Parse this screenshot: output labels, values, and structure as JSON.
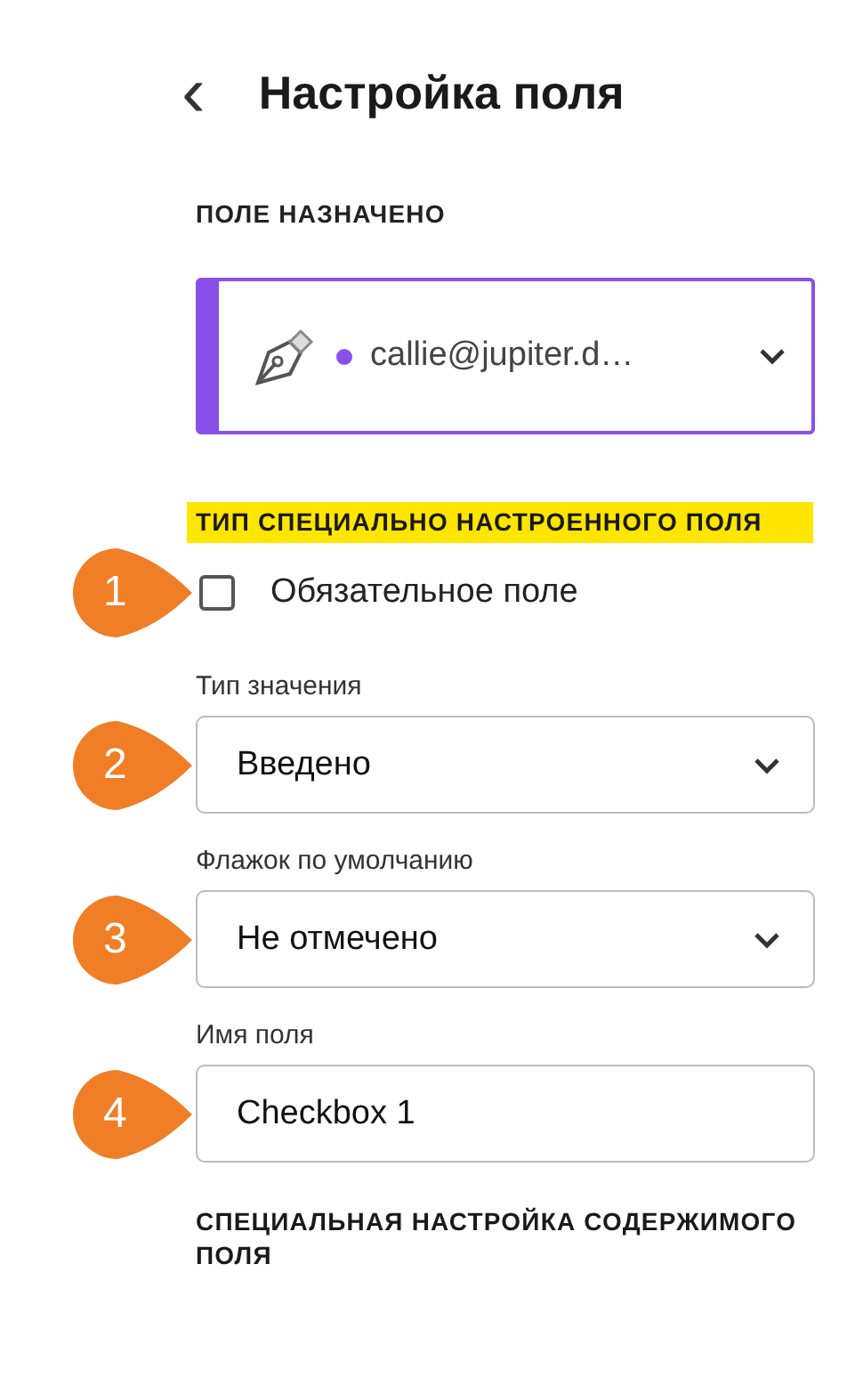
{
  "header": {
    "back_icon": "‹",
    "title": "Настройка поля"
  },
  "assigned": {
    "label": "ПОЛЕ НАЗНАЧЕНО",
    "signer": "callie@jupiter.d…",
    "color": "#8a4fe8"
  },
  "custom_type": {
    "heading": "ТИП СПЕЦИАЛЬНО НАСТРОЕННОГО ПОЛЯ",
    "highlighted": true
  },
  "required": {
    "callout": "1",
    "label": "Обязательное поле",
    "checked": false
  },
  "fields": [
    {
      "kind": "dropdown",
      "label": "Тип значения",
      "callout": "2",
      "value": "Введено"
    },
    {
      "kind": "dropdown",
      "label": "Флажок по умолчанию",
      "callout": "3",
      "value": "Не отмечено"
    },
    {
      "kind": "input",
      "label": "Имя поля",
      "callout": "4",
      "value": "Checkbox 1"
    }
  ],
  "content_heading": "СПЕЦИАЛЬНАЯ НАСТРОЙКА СОДЕРЖИМОГО ПОЛЯ"
}
